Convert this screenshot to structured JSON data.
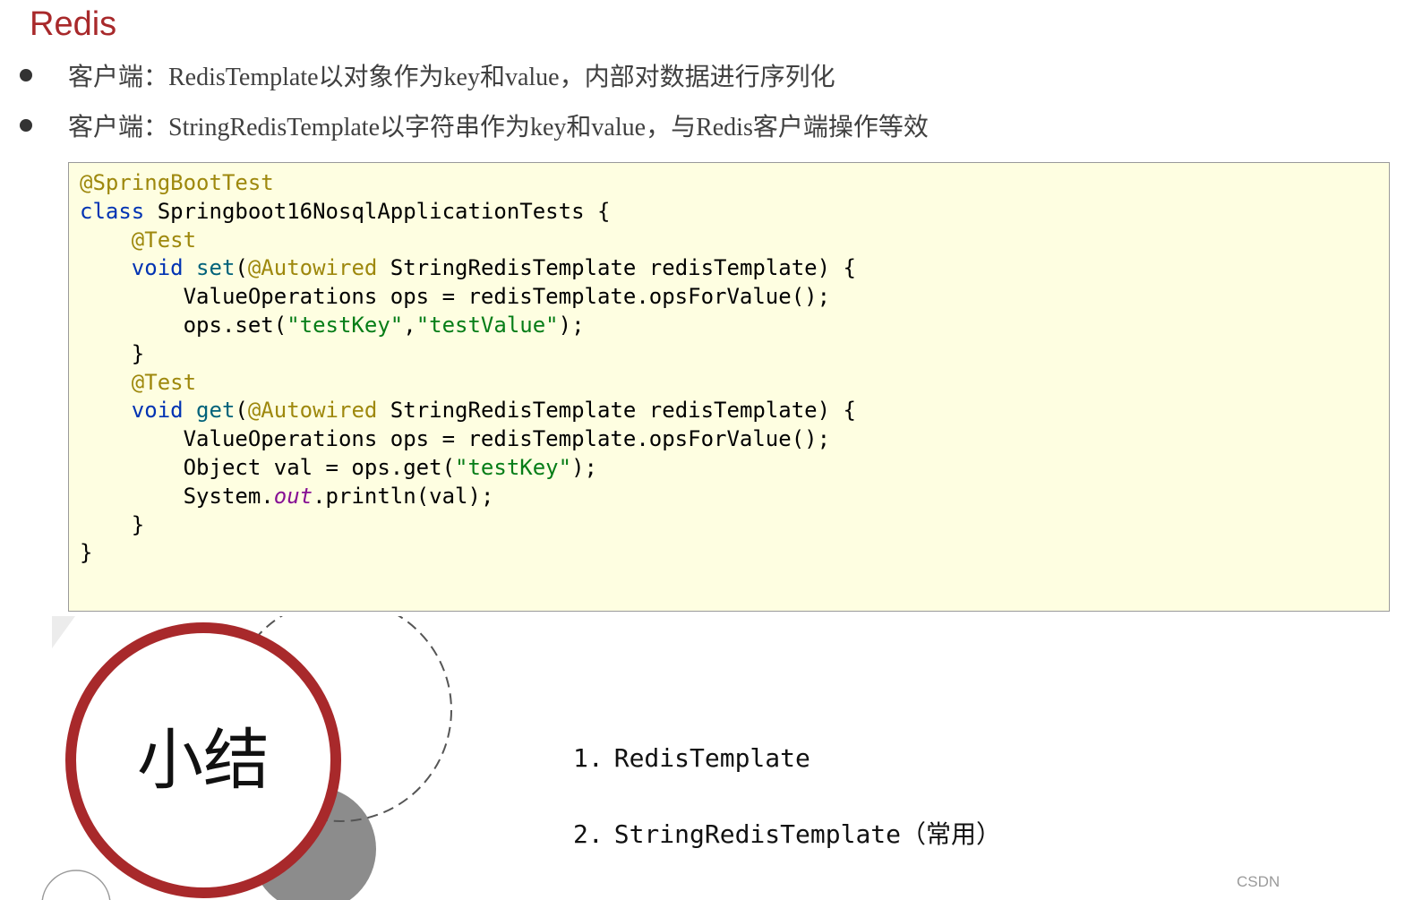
{
  "slide": {
    "title": "Redis",
    "bullets": [
      "客户端：RedisTemplate以对象作为key和value，内部对数据进行序列化",
      "客户端：StringRedisTemplate以字符串作为key和value，与Redis客户端操作等效"
    ]
  },
  "code": {
    "line1": "@SpringBootTest",
    "line2_kw": "class",
    "line2_rest": " Springboot16NosqlApplicationTests {",
    "line3": "@Test",
    "line4_kw": "void",
    "line4_fn": "set",
    "line4_open": "(",
    "line4_ann": "@Autowired",
    "line4_rest": " StringRedisTemplate redisTemplate) {",
    "line5": "ValueOperations ops = redisTemplate.opsForValue();",
    "line6_pre": "ops.set(",
    "line6_s1": "\"testKey\"",
    "line6_comma": ",",
    "line6_s2": "\"testValue\"",
    "line6_post": ");",
    "line7": "}",
    "line8": "@Test",
    "line9_kw": "void",
    "line9_fn": "get",
    "line9_open": "(",
    "line9_ann": "@Autowired",
    "line9_rest": " StringRedisTemplate redisTemplate) {",
    "line10": "ValueOperations ops = redisTemplate.opsForValue();",
    "line11_pre": "Object val = ops.get(",
    "line11_s": "\"testKey\"",
    "line11_post": ");",
    "line12_pre": "System.",
    "line12_out": "out",
    "line12_post": ".println(val);",
    "line13": "}",
    "line14": "}"
  },
  "summary": {
    "label": "小结",
    "items": [
      {
        "num": "1.",
        "text": "RedisTemplate"
      },
      {
        "num": "2.",
        "text": "StringRedisTemplate（常用）"
      }
    ]
  },
  "watermark": "CSDN",
  "colors": {
    "title": "#a8292b",
    "ring": "#a8292b",
    "code_bg": "#fefee1",
    "keyword": "#0033b3",
    "annotation": "#9e880d",
    "string": "#067d17"
  }
}
